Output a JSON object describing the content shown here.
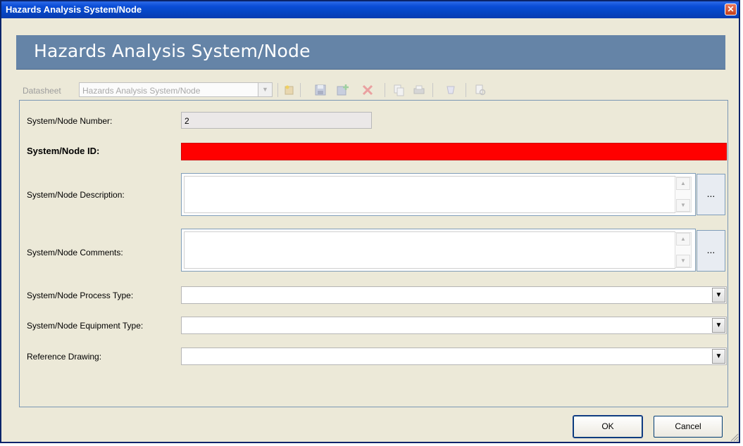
{
  "window": {
    "title": "Hazards Analysis System/Node",
    "close_glyph": "✕"
  },
  "banner": {
    "title": "Hazards Analysis System/Node"
  },
  "toolbar": {
    "datasheet_label": "Datasheet",
    "datasheet_value": "Hazards Analysis System/Node",
    "icons": [
      "new-record-icon",
      "save-icon",
      "save-new-icon",
      "delete-icon",
      "copy-icon",
      "print-icon",
      "refresh-icon",
      "query-icon"
    ]
  },
  "form": {
    "number_label": "System/Node Number:",
    "number_value": "2",
    "id_label": "System/Node ID:",
    "id_value": "",
    "description_label": "System/Node Description:",
    "description_value": "",
    "comments_label": "System/Node Comments:",
    "comments_value": "",
    "process_type_label": "System/Node Process Type:",
    "process_type_value": "",
    "equipment_type_label": "System/Node Equipment Type:",
    "equipment_type_value": "",
    "reference_drawing_label": "Reference Drawing:",
    "reference_drawing_value": "",
    "ellipsis_label": "...",
    "required_color": "#ff0000"
  },
  "buttons": {
    "ok": "OK",
    "cancel": "Cancel"
  }
}
